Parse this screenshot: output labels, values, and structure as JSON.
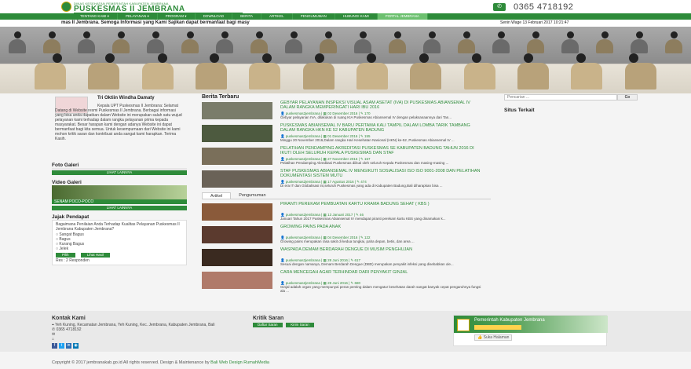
{
  "header": {
    "sub_title": "DINAS KESEHATAN PEMERINTAH KABUPATEN JEMBRANA",
    "title": "PUSKESMAS II JEMBRANA",
    "phone": "0365 4718192"
  },
  "nav": {
    "items": [
      {
        "label": "TENTANG KAMI ▾"
      },
      {
        "label": "PELAYANAN ▾"
      },
      {
        "label": "PROGRAM ▾"
      },
      {
        "label": "DOWNLOAD"
      },
      {
        "label": "BERITA"
      },
      {
        "label": "ARTIKEL"
      },
      {
        "label": "PENGUMUMAN"
      },
      {
        "label": "HUBUNGI KAMI"
      },
      {
        "label": "PORTAL JEMBRANA"
      }
    ]
  },
  "ticker": {
    "text": "mas II Jembrana. Semoga Informasi yang Kami Sajikan dapat bermanfaat bagi masy",
    "date": "Senin Wage 13 Februari 2017 10:21:47"
  },
  "profile": {
    "name": "Tri Oktiin Windha Damaty",
    "text": "Kepala UPT Puskesmas II Jembrana: Selamat Datang di Website resmi Puskesmas II Jembrana. Berbagai informasi yang bisa anda dapatkan dalam Website ini merupakan salah satu wujud pelayanan kami terhadap dalam rangka pelayanan prima kepada masyarakat. Besar harapan kami dengan adanya Website ini dapat bermanfaat bagi kita semua. Untuk kesempurnaan dari Website ini kami mohon kritik saran dan kontribusi anda sangat kami harapkan. Terima Kasih."
  },
  "photo_gallery": {
    "title": "Foto Galeri",
    "button": "LIHAT LAINNYA"
  },
  "video_gallery": {
    "title": "Video Galeri",
    "caption": "SENAM POCO-POCO",
    "button": "LIHAT LAINNYA"
  },
  "poll": {
    "title": "Jajak Pendapat",
    "question": "Bagaimana Penilaian Anda Terhadap Kualitas Pelayanan Puskesmas II Jembrana Kabupaten Jembrana?",
    "options": [
      "Sangat Bagus",
      "Bagus",
      "Kurang Bagus",
      "Jelek"
    ],
    "vote_button": "Pilih",
    "result_button": "Lihat Hasil",
    "summary": "Res : 2 Responden"
  },
  "news": {
    "title": "Berita Terbaru",
    "items": [
      {
        "title": "GEBYAR PELAYANAN INSPEKSI VISUAL ASAM ASETAT (IVA) DI PUSKESMAS ABIANSEMAL IV DALAM RANGKA MEMPERINGATI HARI IBU 2016",
        "author": "puskesmas2jembrana",
        "date": "02 Desember 2016",
        "comments": "170",
        "excerpt": "Gebyar pelayanan IVA, dilakukan di ruang KIA Puskesmas Abiansemal IV dengan pelaksanaannya dari Tan..."
      },
      {
        "title": "PUSKESMAS ABIANSEMAL IV BARU PERTAMA KALI TAMPIL DALAM LOMBA TARIK TAMBANG DALAM RANGKA HKN KE 52 KABUPATEN BADUNG",
        "author": "puskesmas2jembrana",
        "date": "01 Desember 2016",
        "comments": "155",
        "excerpt": "Minggu 20 November 2016,Dalam rangka Hari Kesehatan Nasional (HKN) ke-52 ,Puskesmas Abiansemal IV ..."
      },
      {
        "title": "PELATIHAN PENDAMPING AKREDITASI PUSKESMAS SE KABUPATEN BADUNG TAHUN 2016 DI IKUTI OLEH SELURUH KEPALA PUSKESMAS DAN STAF",
        "author": "puskesmas2jembrana",
        "date": "27 November 2016",
        "comments": "157",
        "excerpt": "Pelatihan Pendamping Akreditasi Puskesmas diikuti oleh seluruh Kepala Puskesmas dan masing-masing ..."
      },
      {
        "title": "STAF PUSKESMAS ABIANSEMAL IV MENGIKUTI SOSIALISASI ISO ISO 9001-2008 DAN PELATIHAN DOKUMENTASI SISTEM MUTU",
        "author": "puskesmas2jembrana",
        "date": "17 Agustus 2016",
        "comments": "474",
        "excerpt": "Di era IT dan Globalisasi ini,seluruh Puskesmas yang ada di Kabupaten Badung,Bali diharapkan bisa ..."
      }
    ]
  },
  "tabs": [
    {
      "label": "Artikel"
    },
    {
      "label": "Pengumuman"
    }
  ],
  "articles": {
    "items": [
      {
        "title": "PIRANTI PEREKAM PEMBUATAN KARTU KRAMA BADUNG SEHAT ( KBS )",
        "author": "puskesmas2jembrana",
        "date": "13 Januari 2017",
        "comments": "46",
        "excerpt": "Januari Tahun 2017 Puskesmas Abiansemal IV mendapat piranti perekam kartu KBS yang dinamakan k..."
      },
      {
        "title": "GROWING PAINS PADA ANAK",
        "author": "puskesmas2jembrana",
        "date": "04 Desember 2016",
        "comments": "122",
        "excerpt": "Growing pains merupakan rasa sakit di kedua tungkai, paha depan, betis, dan area ..."
      },
      {
        "title": "WASPADA DEMAM BERDARAH DENGUE DI MUSIM PENGHUJAN",
        "author": "puskesmas2jembrana",
        "date": "28 Juni 2016",
        "comments": "617",
        "excerpt": "Sesuai dengan namanya, Demam Berdarah Dengue (DBD) merupakan penyakit infeksi yang disebabkan ole..."
      },
      {
        "title": "CARA MENCEGAH AGAR TERHINDAR DARI PENYAKIT GINJAL",
        "author": "puskesmas2jembrana",
        "date": "28 Juni 2016",
        "comments": "680",
        "excerpt": "Ginjal adalah organ yang mempunyai peran penting dalam mengatur kesehatan darah sangat banyak cepat pengaruhnya fungsi ala ..."
      }
    ]
  },
  "sidebar_right": {
    "search_placeholder": "Pencarian ...",
    "search_button": "Go",
    "stats_title": "Situs Terkait"
  },
  "footer": {
    "contact_title": "Kontak Kami",
    "address": "Yeh Kuning, Kecamatan Jembrana, Yeh Kuning, Kec. Jembrana, Kabupaten Jembrana, Bali",
    "phone": "0365 4718192",
    "suggestion_title": "Kritik Saran",
    "suggestion_button": "Daftar Saran",
    "send_button": "Kirim Saran",
    "fb_title": "Pemerintah Kabupaten Jembrana",
    "fb_likes": "Suka Halaman",
    "copyright_pre": "Copyright © 2017 jembranakab.go.id All rights reserved. Design & Maintenance by",
    "copyright_link": "Bali Web Design RumahMedia"
  },
  "colors": {
    "brand_green": "#2e8b3a",
    "nav_active": "#6cc06f"
  }
}
